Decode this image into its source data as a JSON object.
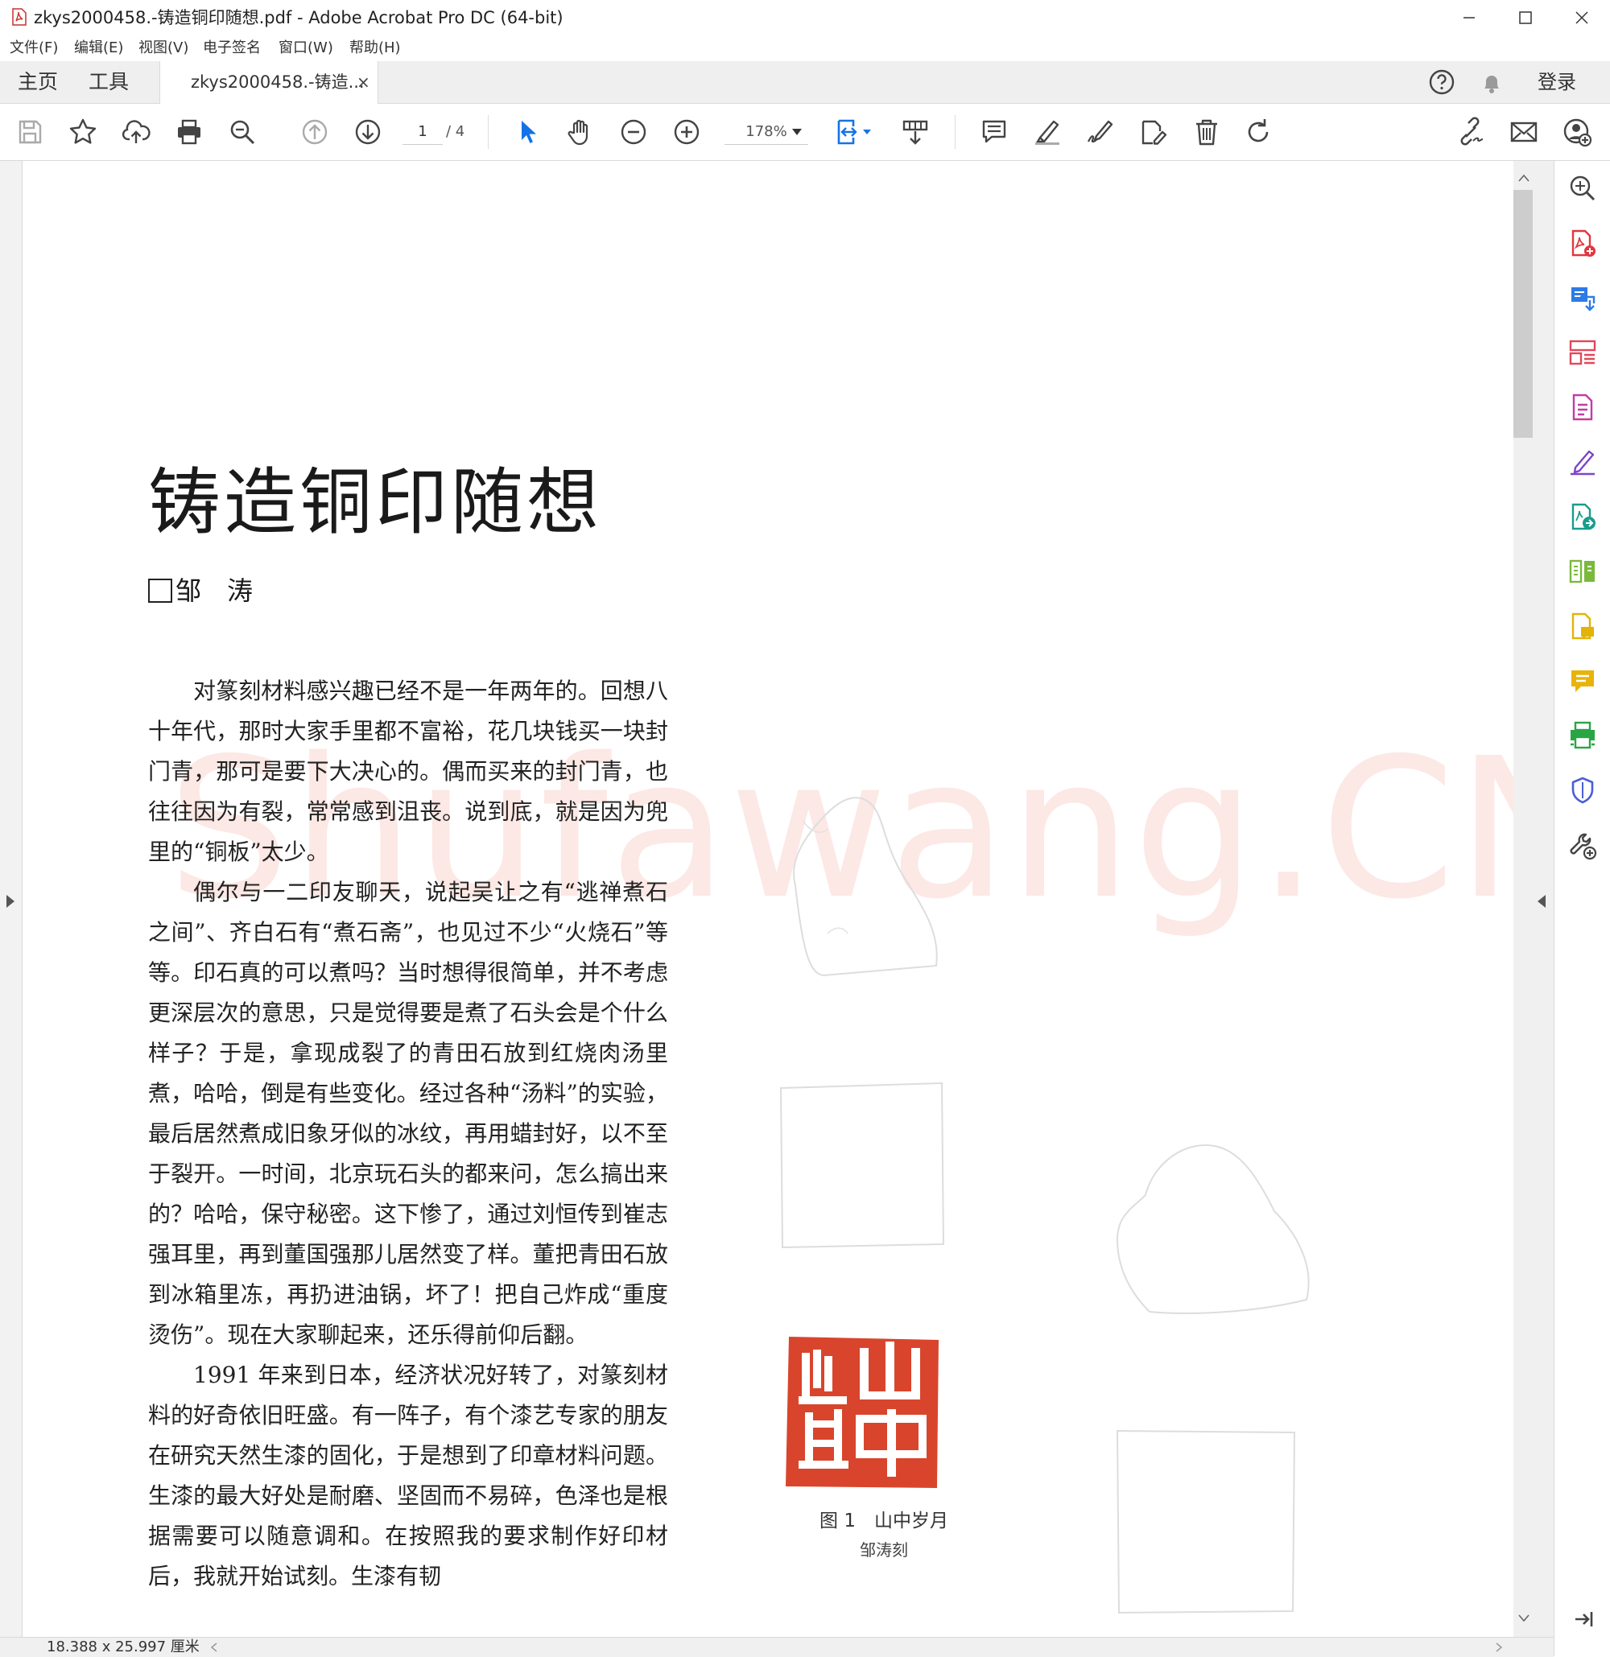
{
  "window": {
    "title": "zkys2000458.-铸造铜印随想.pdf - Adobe Acrobat Pro DC (64-bit)"
  },
  "menu": [
    "文件(F)",
    "编辑(E)",
    "视图(V)",
    "电子签名",
    "窗口(W)",
    "帮助(H)"
  ],
  "tabs": {
    "home": "主页",
    "tools": "工具",
    "document": "zkys2000458.-铸造...",
    "close": "×",
    "sign_in": "登录"
  },
  "toolbar": {
    "page_current": "1",
    "page_total": "/ 4",
    "zoom": "178%"
  },
  "status": {
    "page_size": "18.388 x 25.997 厘米"
  },
  "document": {
    "title": "铸造铜印随想",
    "author": "邹　涛",
    "paragraphs": [
      "对篆刻材料感兴趣已经不是一年两年的。回想八十年代，那时大家手里都不富裕，花几块钱买一块封门青，那可是要下大决心的。偶而买来的封门青，也往往因为有裂，常常感到沮丧。说到底，就是因为兜里的“铜板”太少。",
      "偶尔与一二印友聊天，说起吴让之有“逃禅煮石之间”、齐白石有“煮石斋”，也见过不少“火烧石”等等。印石真的可以煮吗？当时想得很简单，并不考虑更深层次的意思，只是觉得要是煮了石头会是个什么样子？于是，拿现成裂了的青田石放到红烧肉汤里煮，哈哈，倒是有些变化。经过各种“汤料”的实验，最后居然煮成旧象牙似的冰纹，再用蜡封好，以不至于裂开。一时间，北京玩石头的都来问，怎么搞出来的？哈哈，保守秘密。这下惨了，通过刘恒传到崔志强耳里，再到董国强那儿居然变了样。董把青田石放到冰箱里冻，再扔进油锅，坏了！把自己炸成“重度烫伤”。现在大家聊起来，还乐得前仰后翻。",
      "1991 年来到日本，经济状况好转了，对篆刻材料的好奇依旧旺盛。有一阵子，有个漆艺专家的朋友在研究天然生漆的固化，于是想到了印章材料问题。生漆的最大好处是耐磨、坚固而不易碎，色泽也是根据需要可以随意调和。在按照我的要求制作好印材后，我就开始试刻。生漆有韧"
    ],
    "watermark": "Shufawang.CN",
    "figure": {
      "caption": "图 1　山中岁月",
      "credit": "邹涛刻",
      "seal_chars": [
        "岁",
        "月",
        "山",
        "中"
      ]
    }
  },
  "colors": {
    "accent_blue": "#1473e6",
    "seal_red": "#d8452c",
    "watermark": "#ee6e5a"
  }
}
